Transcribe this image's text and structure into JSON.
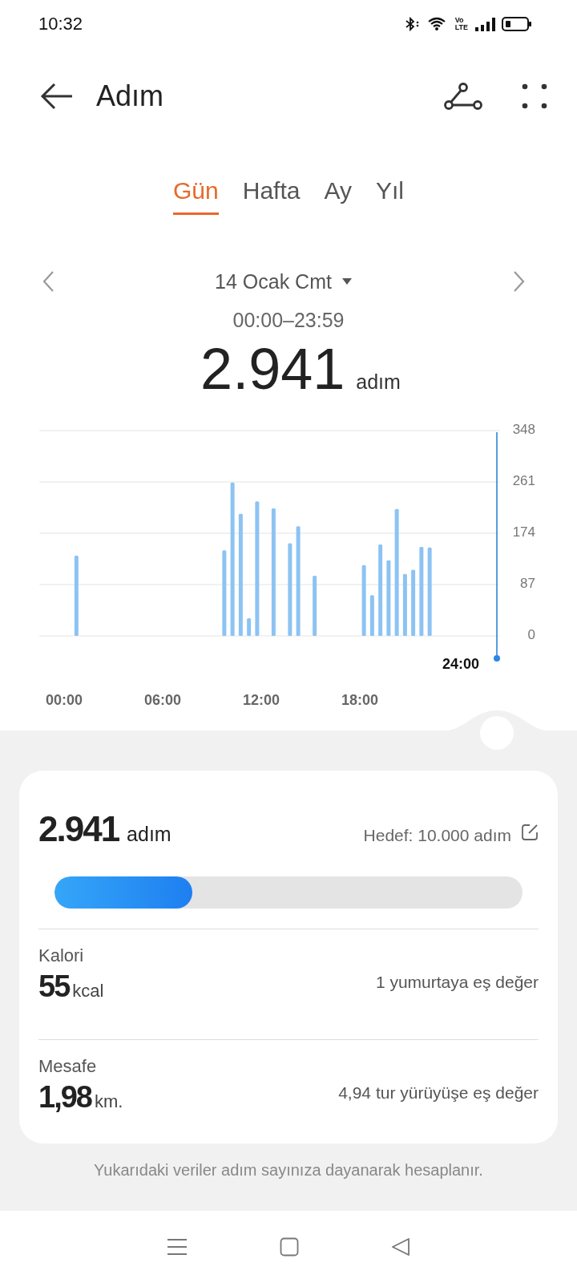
{
  "status_bar": {
    "time": "10:32",
    "volte": [
      "Vo",
      "LTE"
    ]
  },
  "header": {
    "title": "Adım"
  },
  "tabs": [
    {
      "label": "Gün",
      "selected": true
    },
    {
      "label": "Hafta",
      "selected": false
    },
    {
      "label": "Ay",
      "selected": false
    },
    {
      "label": "Yıl",
      "selected": false
    }
  ],
  "date": {
    "label": "14 Ocak Cmt",
    "range": "00:00–23:59"
  },
  "total": {
    "value": "2.941",
    "unit": "adım"
  },
  "chart": {
    "cursor_label": "24:00",
    "chart_data": {
      "type": "bar",
      "x": [
        0.75,
        9.75,
        10.25,
        10.75,
        11.25,
        11.75,
        12.75,
        13.75,
        14.25,
        15.25,
        18.25,
        18.75,
        19.25,
        19.75,
        20.25,
        20.75,
        21.25,
        21.75,
        22.25
      ],
      "values": [
        136,
        145,
        260,
        207,
        30,
        228,
        216,
        157,
        186,
        102,
        120,
        69,
        155,
        128,
        215,
        105,
        112,
        151,
        150
      ],
      "xlim": [
        -1.5,
        26.5
      ],
      "ylim": [
        0,
        348
      ],
      "grid": true,
      "xticks": [
        {
          "value": 0,
          "label": "00:00"
        },
        {
          "value": 6,
          "label": "06:00"
        },
        {
          "value": 12,
          "label": "12:00"
        },
        {
          "value": 18,
          "label": "18:00"
        }
      ],
      "yticks": [
        0,
        87,
        174,
        261,
        348
      ]
    }
  },
  "summary": {
    "steps": "2.941",
    "unit": "adım",
    "goal": "Hedef: 10.000 adım",
    "level": 0.2941,
    "metrics": [
      {
        "label": "Kalori",
        "value": "55",
        "unit": "kcal",
        "equivalent": "1 yumurtaya eş değer"
      },
      {
        "label": "Mesafe",
        "value": "1,98",
        "unit": "km.",
        "equivalent": "4,94 tur yürüyüşe eş değer"
      }
    ]
  },
  "footnote": "Yukarıdaki veriler adım sayınıza dayanarak hesaplanır."
}
